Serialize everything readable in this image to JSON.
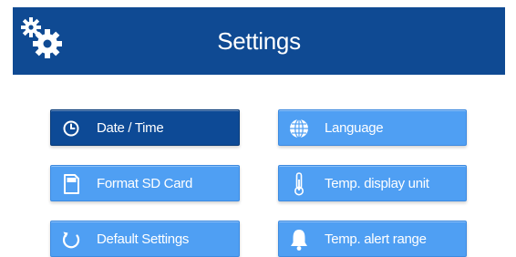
{
  "header": {
    "title": "Settings",
    "icon": "gears-icon",
    "background": "#0f4a93"
  },
  "buttons": [
    {
      "label": "Date / Time",
      "icon": "clock-icon",
      "selected": true
    },
    {
      "label": "Language",
      "icon": "globe-icon",
      "selected": false
    },
    {
      "label": "Format SD Card",
      "icon": "sd-card-icon",
      "selected": false
    },
    {
      "label": "Temp. display unit",
      "icon": "thermometer-icon",
      "selected": false
    },
    {
      "label": "Default Settings",
      "icon": "reset-icon",
      "selected": false
    },
    {
      "label": "Temp. alert range",
      "icon": "bell-icon",
      "selected": false
    }
  ],
  "colors": {
    "button": "#4f9ff3",
    "button_selected": "#0d4a96",
    "text": "#ffffff"
  }
}
